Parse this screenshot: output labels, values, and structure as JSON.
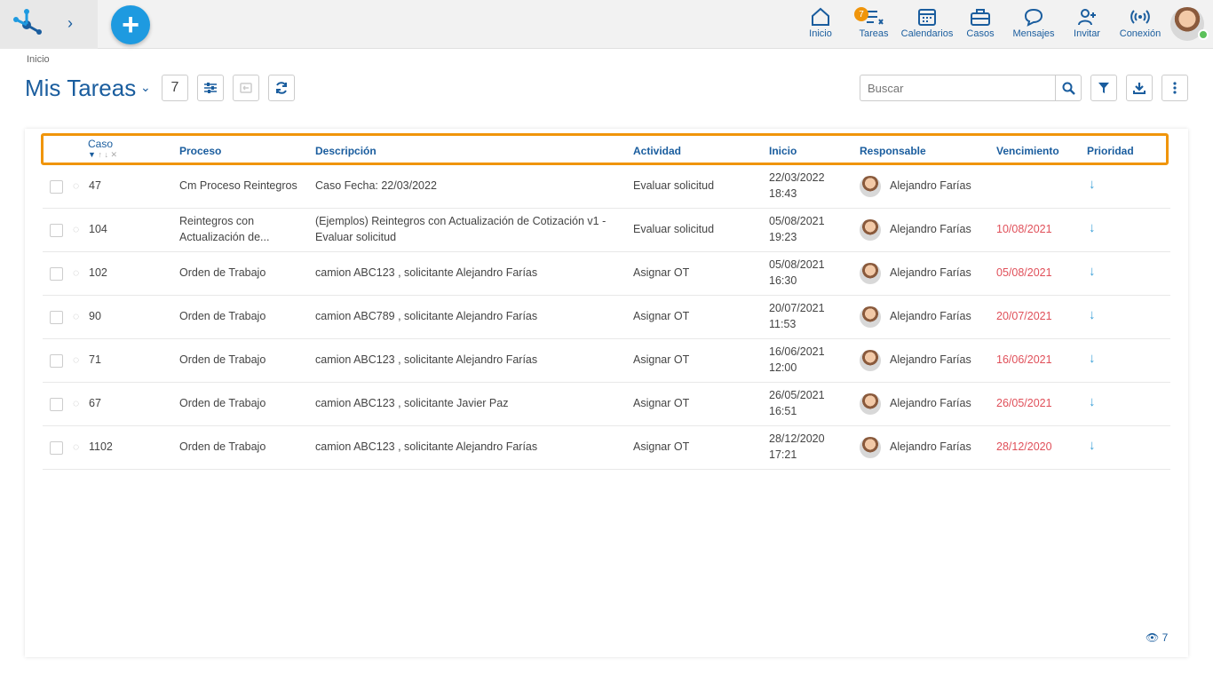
{
  "nav": {
    "items": [
      {
        "label": "Inicio",
        "icon": "home-icon"
      },
      {
        "label": "Tareas",
        "icon": "tasks-icon"
      },
      {
        "label": "Calendarios",
        "icon": "calendar-icon"
      },
      {
        "label": "Casos",
        "icon": "briefcase-icon"
      },
      {
        "label": "Mensajes",
        "icon": "chat-icon"
      },
      {
        "label": "Invitar",
        "icon": "invite-user-icon"
      },
      {
        "label": "Conexión",
        "icon": "wifi-icon"
      }
    ],
    "tasks_badge": "7"
  },
  "breadcrumb": "Inicio",
  "page": {
    "title": "Mis Tareas",
    "count": "7"
  },
  "search": {
    "placeholder": "Buscar"
  },
  "columns": [
    "Caso",
    "Proceso",
    "Descripción",
    "Actividad",
    "Inicio",
    "Responsable",
    "Vencimiento",
    "Prioridad"
  ],
  "rows": [
    {
      "caso": "47",
      "proceso": "Cm Proceso Reintegros",
      "proceso2": "",
      "desc": "Caso Fecha: 22/03/2022",
      "desc2": "",
      "actividad": "Evaluar solicitud",
      "inicio_date": "22/03/2022",
      "inicio_time": "18:43",
      "responsable": "Alejandro Farías",
      "vencimiento": ""
    },
    {
      "caso": "104",
      "proceso": "Reintegros con",
      "proceso2": "Actualización de...",
      "desc": "(Ejemplos) Reintegros con Actualización de Cotización v1 -",
      "desc2": "Evaluar solicitud",
      "actividad": "Evaluar solicitud",
      "inicio_date": "05/08/2021",
      "inicio_time": "19:23",
      "responsable": "Alejandro Farías",
      "vencimiento": "10/08/2021"
    },
    {
      "caso": "102",
      "proceso": "Orden de Trabajo",
      "proceso2": "",
      "desc": "camion ABC123 , solicitante Alejandro Farías",
      "desc2": "",
      "actividad": "Asignar OT",
      "inicio_date": "05/08/2021",
      "inicio_time": "16:30",
      "responsable": "Alejandro Farías",
      "vencimiento": "05/08/2021"
    },
    {
      "caso": "90",
      "proceso": "Orden de Trabajo",
      "proceso2": "",
      "desc": "camion ABC789 , solicitante Alejandro Farías",
      "desc2": "",
      "actividad": "Asignar OT",
      "inicio_date": "20/07/2021",
      "inicio_time": "11:53",
      "responsable": "Alejandro Farías",
      "vencimiento": "20/07/2021"
    },
    {
      "caso": "71",
      "proceso": "Orden de Trabajo",
      "proceso2": "",
      "desc": "camion ABC123 , solicitante Alejandro Farías",
      "desc2": "",
      "actividad": "Asignar OT",
      "inicio_date": "16/06/2021",
      "inicio_time": "12:00",
      "responsable": "Alejandro Farías",
      "vencimiento": "16/06/2021"
    },
    {
      "caso": "67",
      "proceso": "Orden de Trabajo",
      "proceso2": "",
      "desc": "camion ABC123 , solicitante Javier Paz",
      "desc2": "",
      "actividad": "Asignar OT",
      "inicio_date": "26/05/2021",
      "inicio_time": "16:51",
      "responsable": "Alejandro Farías",
      "vencimiento": "26/05/2021"
    },
    {
      "caso": "1102",
      "proceso": "Orden de Trabajo",
      "proceso2": "",
      "desc": "camion ABC123 , solicitante Alejandro Farías",
      "desc2": "",
      "actividad": "Asignar OT",
      "inicio_date": "28/12/2020",
      "inicio_time": "17:21",
      "responsable": "Alejandro Farías",
      "vencimiento": "28/12/2020"
    }
  ],
  "footer": {
    "visible_count": "7"
  },
  "colors": {
    "accent": "#1a5d9e",
    "fab": "#1e9ae0",
    "highlight": "#f0950b",
    "overdue": "#e0505a"
  }
}
